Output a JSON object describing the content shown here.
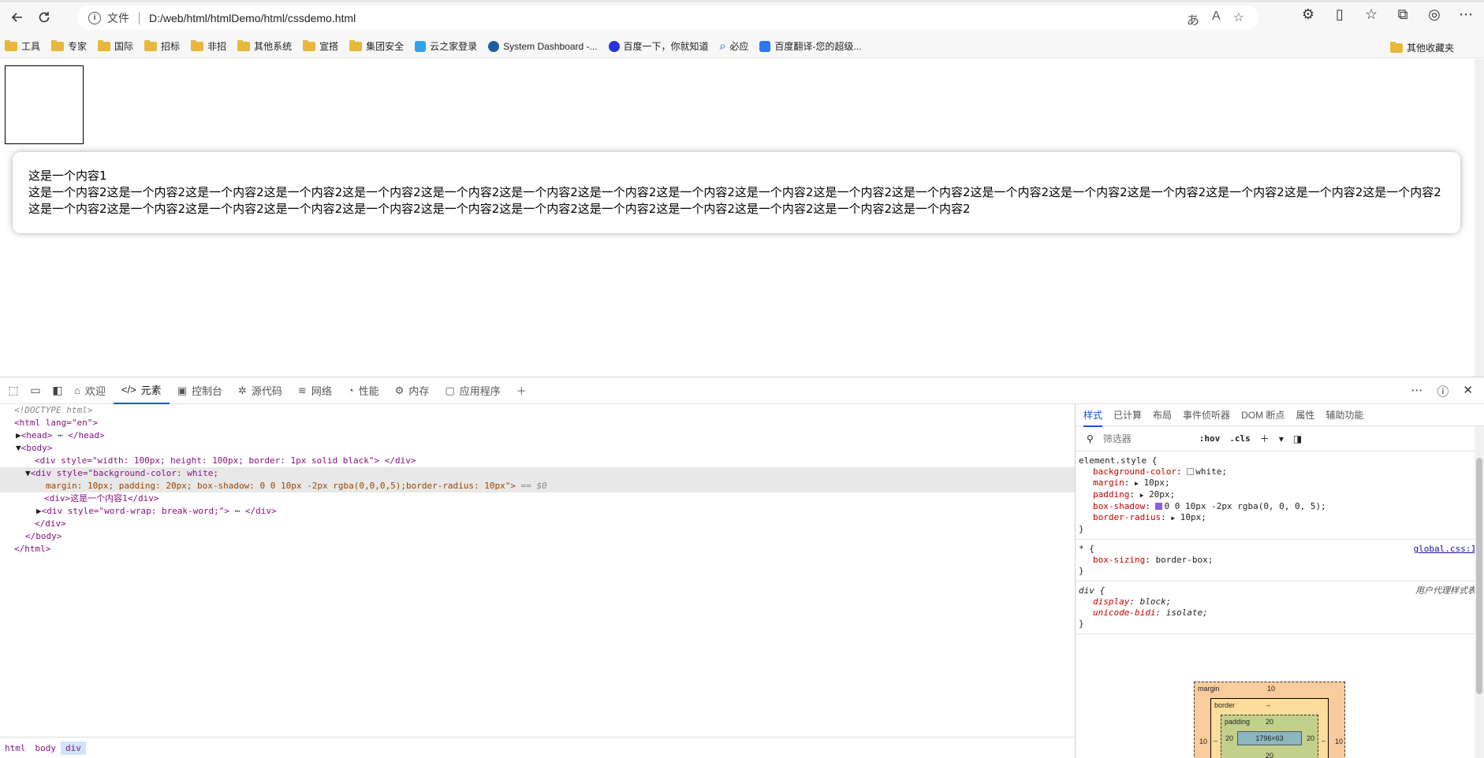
{
  "browser": {
    "address_label": "文件",
    "url": "D:/web/html/htmlDemo/html/cssdemo.html",
    "bookmarks": [
      {
        "label": "工具",
        "type": "folder"
      },
      {
        "label": "专家",
        "type": "folder"
      },
      {
        "label": "国际",
        "type": "folder"
      },
      {
        "label": "招标",
        "type": "folder"
      },
      {
        "label": "非招",
        "type": "folder"
      },
      {
        "label": "其他系统",
        "type": "folder"
      },
      {
        "label": "宣搭",
        "type": "folder"
      },
      {
        "label": "集团安全",
        "type": "folder"
      },
      {
        "label": "云之家登录",
        "type": "site",
        "color": "#2ea3f2"
      },
      {
        "label": "System Dashboard -...",
        "type": "site",
        "color": "#1d5e9c"
      },
      {
        "label": "百度一下，你就知道",
        "type": "site",
        "color": "#2932e1"
      },
      {
        "label": "必应",
        "type": "site",
        "color": "#0c8484"
      },
      {
        "label": "百度翻译-您的超级...",
        "type": "site",
        "color": "#2a78f6"
      }
    ],
    "other_bookmarks": "其他收藏夹"
  },
  "page": {
    "content1": "这是一个内容1",
    "content2": "这是一个内容2这是一个内容2这是一个内容2这是一个内容2这是一个内容2这是一个内容2这是一个内容2这是一个内容2这是一个内容2这是一个内容2这是一个内容2这是一个内容2这是一个内容2这是一个内容2这是一个内容2这是一个内容2这是一个内容2这是一个内容2这是一个内容2这是一个内容2这是一个内容2这是一个内容2这是一个内容2这是一个内容2这是一个内容2这是一个内容2这是一个内容2这是一个内容2这是一个内容2这是一个内容2"
  },
  "devtools": {
    "tabs": [
      "欢迎",
      "元素",
      "控制台",
      "源代码",
      "网络",
      "性能",
      "内存",
      "应用程序"
    ],
    "active_tab": "元素",
    "dom": {
      "doctype": "<!DOCTYPE html>",
      "html_open": "<html lang=\"en\">",
      "head": "<head>",
      "head_close": "</head>",
      "body": "<body>",
      "div1": "<div style=\"width: 100px; height: 100px; border: 1px solid black\"> </div>",
      "div2_a": "<div style=\"background-color: white;",
      "div2_b": "margin: 10px; padding: 20px; box-shadow: 0 0 10px -2px rgba(0,0,0,5);border-radius: 10px\">",
      "div2_marker": "== $0",
      "div3": "<div>这是一个内容1</div>",
      "div4": "<div style=\"word-wrap: break-word;\">",
      "div4_close": "</div>",
      "div_close": "</div>",
      "body_close": "</body>",
      "html_close": "</html>"
    },
    "breadcrumbs": [
      "html",
      "body",
      "div"
    ],
    "styles_tabs": [
      "样式",
      "已计算",
      "布局",
      "事件侦听器",
      "DOM 断点",
      "属性",
      "辅助功能"
    ],
    "filter_placeholder": "筛选器",
    "hov": ":hov",
    "cls": ".cls",
    "rules": {
      "element_style": {
        "selector": "element.style {",
        "props": [
          {
            "name": "background-color",
            "value": "white;"
          },
          {
            "name": "margin",
            "value": "10px;"
          },
          {
            "name": "padding",
            "value": "20px;"
          },
          {
            "name": "box-shadow",
            "value": "0 0 10px -2px rgba(0, 0, 0, 5);"
          },
          {
            "name": "border-radius",
            "value": "10px;"
          }
        ]
      },
      "universal": {
        "selector": "* {",
        "source": "global.css:1",
        "prop_name": "box-sizing",
        "prop_value": "border-box;"
      },
      "div_ua": {
        "selector": "div {",
        "source": "用户代理样式表",
        "props": [
          {
            "name": "display",
            "value": "block;"
          },
          {
            "name": "unicode-bidi",
            "value": "isolate;"
          }
        ]
      }
    },
    "box_model": {
      "margin_label": "margin",
      "margin_value": "10",
      "border_label": "border",
      "border_value": "–",
      "padding_label": "padding",
      "padding_value": "20",
      "content": "1796×63",
      "side_left": "10",
      "side_right": "10",
      "pad_left": "20",
      "pad_right": "20",
      "pad_bottom": "20",
      "border_left": "–",
      "border_right": "–"
    }
  }
}
